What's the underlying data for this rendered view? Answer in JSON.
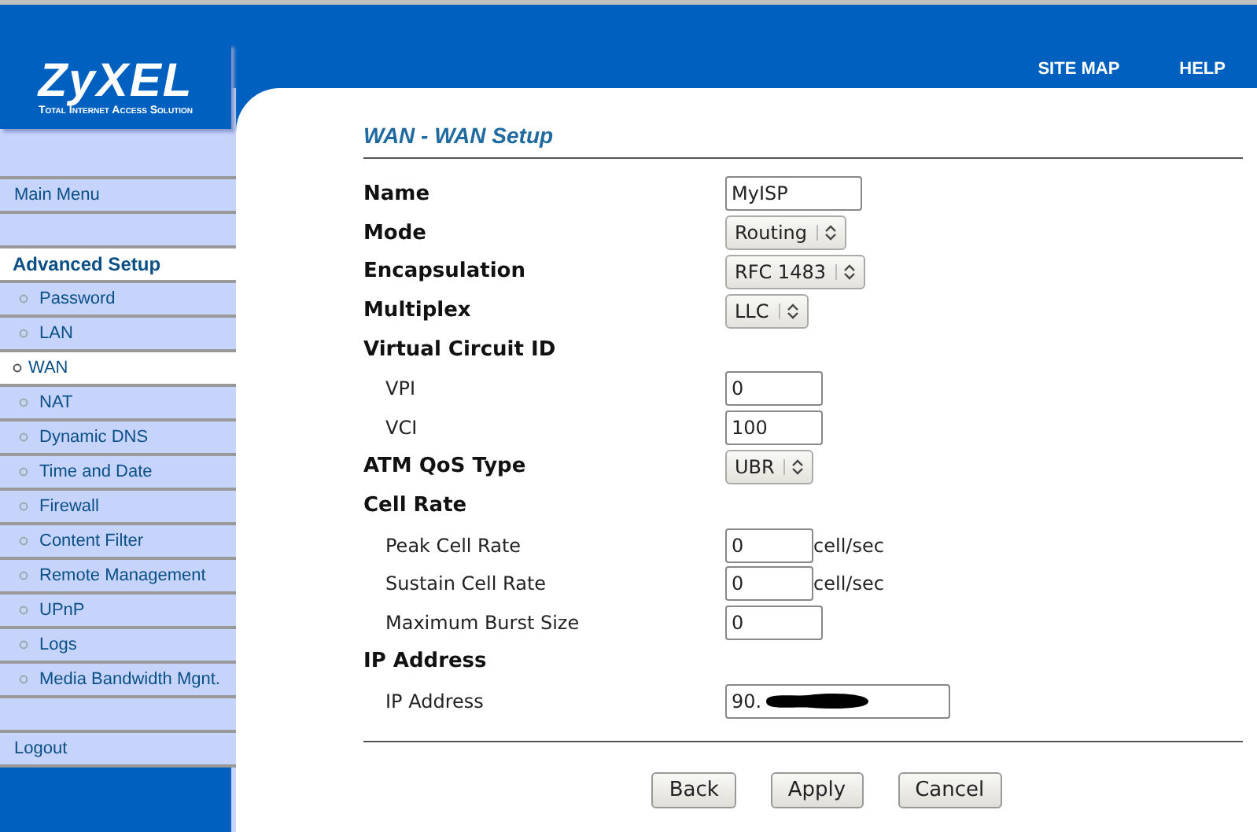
{
  "header": {
    "logo": "ZyXEL",
    "tagline": "Total Internet Access Solution",
    "links": [
      "SITE MAP",
      "HELP"
    ]
  },
  "sidebar": {
    "items": [
      {
        "kind": "link",
        "label": "Main Menu",
        "selected": false
      },
      {
        "kind": "spacer"
      },
      {
        "kind": "section",
        "label": "Advanced Setup",
        "selected": true
      },
      {
        "kind": "sub",
        "label": "Password",
        "selected": false
      },
      {
        "kind": "sub",
        "label": "LAN",
        "selected": false
      },
      {
        "kind": "sub",
        "label": "WAN",
        "selected": true
      },
      {
        "kind": "sub",
        "label": "NAT",
        "selected": false
      },
      {
        "kind": "sub",
        "label": "Dynamic DNS",
        "selected": false
      },
      {
        "kind": "sub",
        "label": "Time and Date",
        "selected": false
      },
      {
        "kind": "sub",
        "label": "Firewall",
        "selected": false
      },
      {
        "kind": "sub",
        "label": "Content Filter",
        "selected": false
      },
      {
        "kind": "sub",
        "label": "Remote Management",
        "selected": false
      },
      {
        "kind": "sub",
        "label": "UPnP",
        "selected": false
      },
      {
        "kind": "sub",
        "label": "Logs",
        "selected": false
      },
      {
        "kind": "sub",
        "label": "Media Bandwidth Mgnt.",
        "selected": false
      },
      {
        "kind": "spacer"
      },
      {
        "kind": "link",
        "label": "Logout",
        "selected": false
      }
    ]
  },
  "page_title": "WAN - WAN Setup",
  "form": {
    "rows": [
      {
        "kind": "input",
        "label": "Name",
        "value": "MyISP"
      },
      {
        "kind": "select",
        "label": "Mode",
        "value": "Routing"
      },
      {
        "kind": "select",
        "label": "Encapsulation",
        "value": "RFC 1483"
      },
      {
        "kind": "select",
        "label": "Multiplex",
        "value": "LLC"
      },
      {
        "kind": "heading",
        "label": "Virtual Circuit ID",
        "children": [
          {
            "kind": "input",
            "label": "VPI",
            "value": "0"
          },
          {
            "kind": "input",
            "label": "VCI",
            "value": "100"
          }
        ]
      },
      {
        "kind": "select",
        "label": "ATM QoS Type",
        "value": "UBR"
      },
      {
        "kind": "heading",
        "label": "Cell Rate",
        "children": [
          {
            "kind": "input",
            "label": "Peak Cell Rate",
            "value": "0",
            "unit": "cell/sec"
          },
          {
            "kind": "input",
            "label": "Sustain Cell Rate",
            "value": "0",
            "unit": "cell/sec"
          },
          {
            "kind": "input",
            "label": "Maximum Burst Size",
            "value": "0"
          }
        ]
      },
      {
        "kind": "heading",
        "label": "IP Address",
        "children": [
          {
            "kind": "input",
            "label": "IP Address",
            "value": "90.",
            "redacted": true
          }
        ]
      }
    ]
  },
  "buttons": [
    "Back",
    "Apply",
    "Cancel"
  ]
}
